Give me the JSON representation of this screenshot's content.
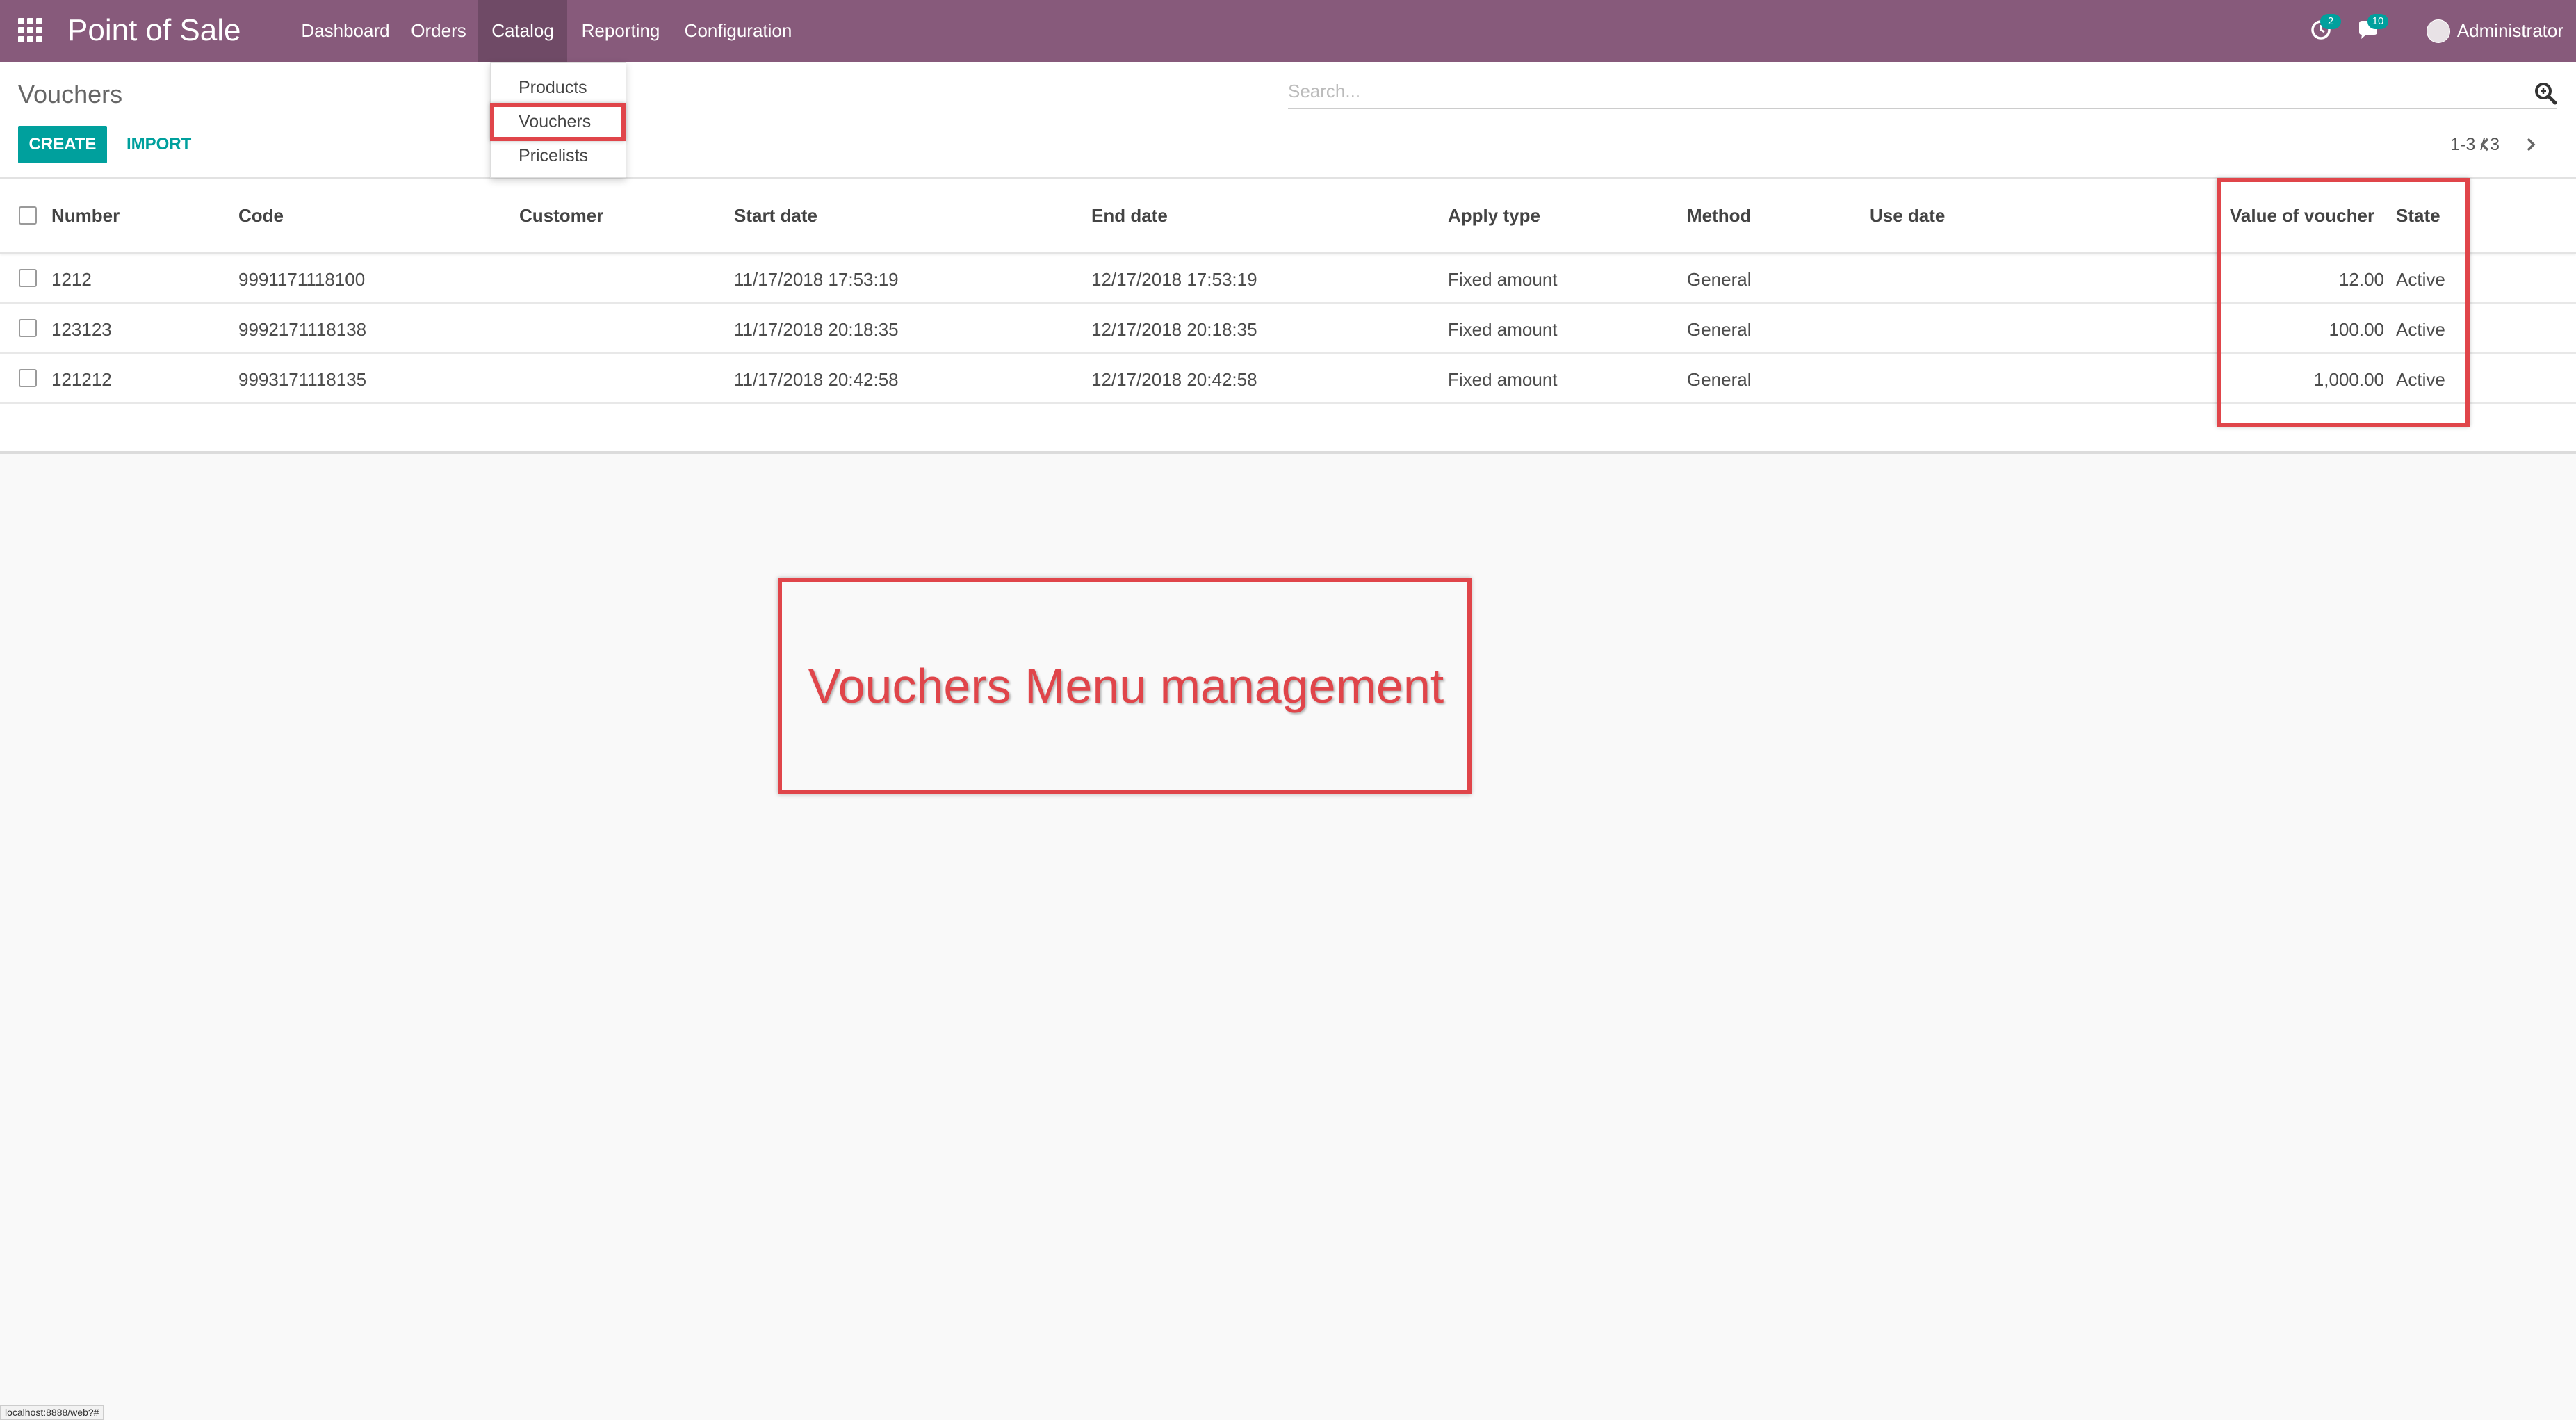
{
  "navbar": {
    "app_title": "Point of Sale",
    "menu": [
      {
        "label": "Dashboard"
      },
      {
        "label": "Orders"
      },
      {
        "label": "Catalog"
      },
      {
        "label": "Reporting"
      },
      {
        "label": "Configuration"
      }
    ],
    "active_menu": "Catalog",
    "activity_count": "2",
    "messages_count": "10",
    "user_name": "Administrator",
    "color": "#875a7b"
  },
  "catalog_dropdown": {
    "items": [
      {
        "label": "Products"
      },
      {
        "label": "Vouchers"
      },
      {
        "label": "Pricelists"
      }
    ],
    "highlighted": "Vouchers"
  },
  "control_panel": {
    "breadcrumb": "Vouchers",
    "create_label": "CREATE",
    "import_label": "IMPORT",
    "search_placeholder": "Search...",
    "pager": "1-3 / 3",
    "accent_color": "#00a09d"
  },
  "table": {
    "columns": [
      "Number",
      "Code",
      "Customer",
      "Start date",
      "End date",
      "Apply type",
      "Method",
      "Use date",
      "Value of voucher",
      "State"
    ],
    "rows": [
      [
        "1212",
        "9991171118100",
        "",
        "11/17/2018 17:53:19",
        "12/17/2018 17:53:19",
        "Fixed amount",
        "General",
        "",
        "12.00",
        "Active"
      ],
      [
        "123123",
        "9992171118138",
        "",
        "11/17/2018 20:18:35",
        "12/17/2018 20:18:35",
        "Fixed amount",
        "General",
        "",
        "100.00",
        "Active"
      ],
      [
        "121212",
        "9993171118135",
        "",
        "11/17/2018 20:42:58",
        "12/17/2018 20:42:58",
        "Fixed amount",
        "General",
        "",
        "1,000.00",
        "Active"
      ]
    ]
  },
  "annotation": {
    "caption": "Vouchers Menu management",
    "color": "#e0454a"
  },
  "status_bar": {
    "url": "localhost:8888/web?#"
  }
}
